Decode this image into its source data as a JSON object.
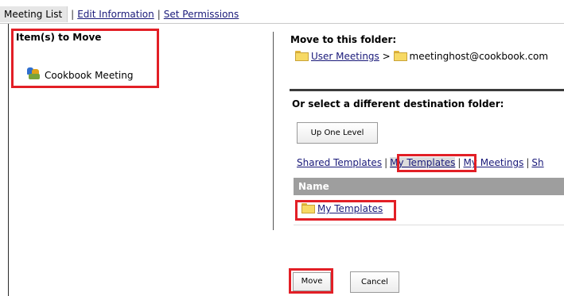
{
  "nav": {
    "tabs": [
      {
        "label": "Meeting List"
      },
      {
        "label": "Edit Information"
      },
      {
        "label": "Set Permissions"
      }
    ],
    "separator": "|"
  },
  "left": {
    "title": "Item(s) to Move",
    "items": [
      {
        "label": "Cookbook Meeting",
        "icon": "meeting-icon"
      }
    ]
  },
  "right": {
    "move_title": "Move to this folder:",
    "breadcrumb": {
      "first": "User Meetings",
      "sep": ">",
      "second": "meetinghost@cookbook.com"
    },
    "other_title": "Or select a different destination folder:",
    "up_button": "Up One Level",
    "dest_tabs": [
      {
        "label": "Shared Templates"
      },
      {
        "label": "My Templates"
      },
      {
        "label": "My Meetings"
      },
      {
        "label": "Sh"
      }
    ],
    "tabs_sep": "|",
    "table": {
      "header": "Name",
      "rows": [
        {
          "label": "My Templates",
          "icon": "folder-icon"
        }
      ]
    }
  },
  "actions": {
    "move": "Move",
    "cancel": "Cancel"
  },
  "colors": {
    "highlight": "#e21f26",
    "link": "#1a1a7a",
    "table_header": "#9e9e9e"
  }
}
